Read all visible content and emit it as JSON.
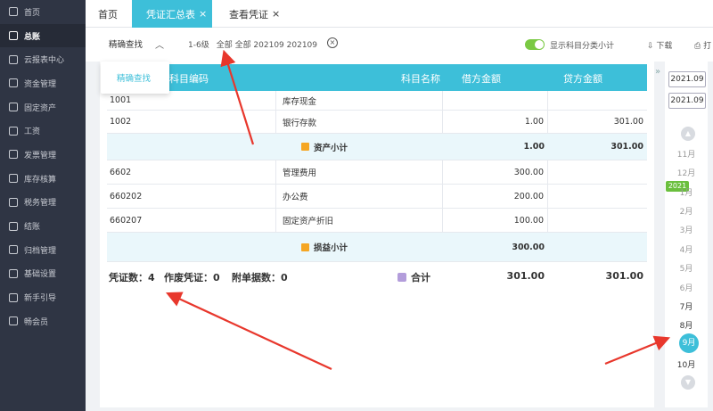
{
  "sidebar": {
    "items": [
      {
        "label": "首页"
      },
      {
        "label": "总账"
      },
      {
        "label": "云报表中心"
      },
      {
        "label": "资金管理"
      },
      {
        "label": "固定资产"
      },
      {
        "label": "工资"
      },
      {
        "label": "发票管理"
      },
      {
        "label": "库存核算"
      },
      {
        "label": "税务管理"
      },
      {
        "label": "结账"
      },
      {
        "label": "归档管理"
      },
      {
        "label": "基础设置"
      },
      {
        "label": "新手引导"
      },
      {
        "label": "畅会员"
      }
    ]
  },
  "tabs": {
    "home": "首页",
    "summary": "凭证汇总表",
    "view": "查看凭证",
    "close": "×"
  },
  "toolbar": {
    "search_mode": "精确查找",
    "level": "1-6级",
    "range": "全部 全部 202109 202109",
    "toggle_label": "显示科目分类小计",
    "download": "下载",
    "print": "打"
  },
  "popup": {
    "option": "精确查找"
  },
  "table": {
    "headers": {
      "code": "科目编码",
      "name": "科目名称",
      "debit": "借方金额",
      "credit": "贷方金额"
    },
    "rows": [
      {
        "code": "1001",
        "name": "库存现金",
        "debit": "",
        "credit": ""
      },
      {
        "code": "1002",
        "name": "银行存款",
        "debit": "1.00",
        "credit": "301.00"
      },
      {
        "subtotal": "资产小计",
        "debit": "1.00",
        "credit": "301.00"
      },
      {
        "code": "6602",
        "name": "管理费用",
        "debit": "300.00",
        "credit": ""
      },
      {
        "code": "660202",
        "name": "办公费",
        "debit": "200.00",
        "credit": ""
      },
      {
        "code": "660207",
        "name": "固定资产折旧",
        "debit": "100.00",
        "credit": ""
      },
      {
        "subtotal": "损益小计",
        "debit": "300.00",
        "credit": ""
      }
    ],
    "footer": {
      "vouchers": "凭证数：4",
      "void": "作废凭证：0",
      "attachments": "附单据数：0",
      "total_label": "合计",
      "total_debit": "301.00",
      "total_credit": "301.00"
    }
  },
  "date_panel": {
    "start": "2021.09",
    "end": "2021.09",
    "year": "2021",
    "months": [
      "11月",
      "12月",
      "1月",
      "2月",
      "3月",
      "4月",
      "5月",
      "6月",
      "7月",
      "8月",
      "9月",
      "10月"
    ],
    "selected": "9月"
  },
  "colors": {
    "accent": "#3dbfd9",
    "sidebar": "#2f3544",
    "toggle": "#7ac943",
    "arrow": "#e8372c"
  }
}
